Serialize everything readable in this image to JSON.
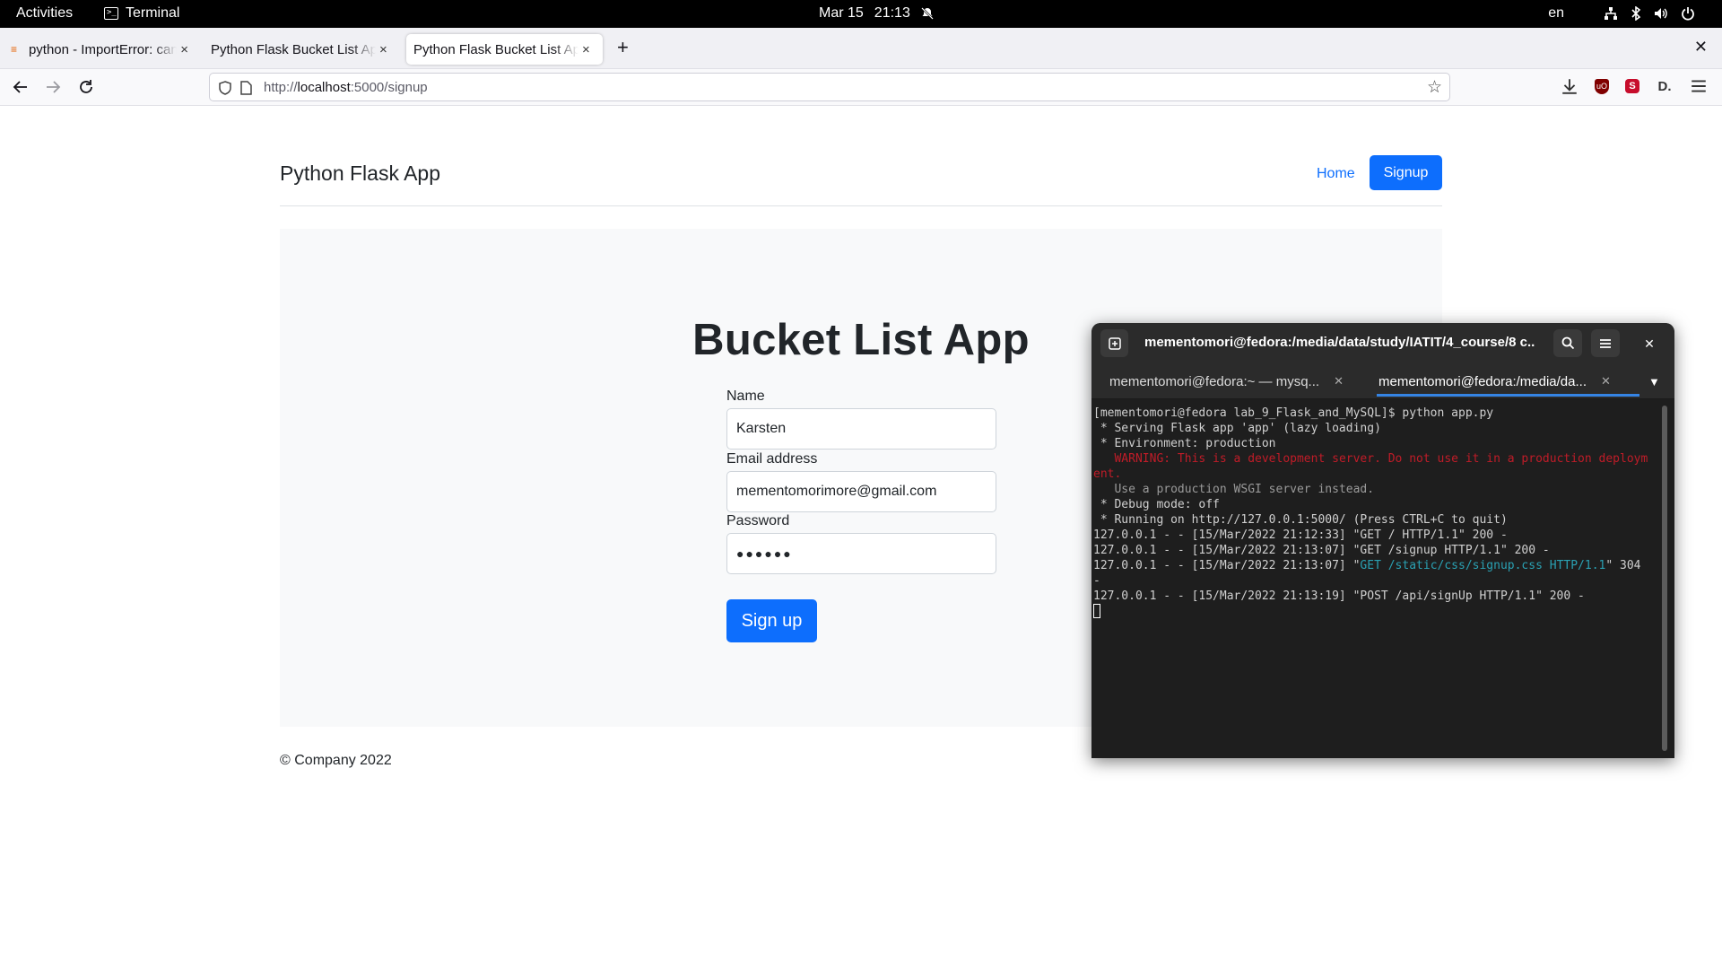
{
  "topbar": {
    "activities": "Activities",
    "app_name": "Terminal",
    "date": "Mar 15",
    "time": "21:13",
    "lang": "en"
  },
  "browser": {
    "tabs": [
      {
        "label": "python - ImportError: cannot import",
        "active": false
      },
      {
        "label": "Python Flask Bucket List App",
        "active": false
      },
      {
        "label": "Python Flask Bucket List App",
        "active": true
      }
    ],
    "url_scheme": "http://",
    "url_host": "localhost",
    "url_path": ":5000/signup"
  },
  "page": {
    "brand": "Python Flask App",
    "nav": {
      "home": "Home",
      "signup": "Signup"
    },
    "heading": "Bucket List App",
    "form": {
      "name_label": "Name",
      "name_value": "Karsten",
      "email_label": "Email address",
      "email_value": "mementomorimore@gmail.com",
      "password_label": "Password",
      "password_value": "●●●●●●",
      "submit_label": "Sign up"
    },
    "footer": "© Company 2022"
  },
  "terminal": {
    "title": "mementomori@fedora:/media/data/study/IATIT/4_course/8 c...",
    "tabs": [
      {
        "label": "mementomori@fedora:~ — mysq...",
        "active": false
      },
      {
        "label": "mementomori@fedora:/media/da...",
        "active": true
      }
    ],
    "lines": {
      "l1": "[mementomori@fedora lab_9_Flask_and_MySQL]$ python app.py",
      "l2": " * Serving Flask app 'app' (lazy loading)",
      "l3": " * Environment: production",
      "l4": "   WARNING: This is a development server. Do not use it in a production deployment.",
      "l5": "   Use a production WSGI server instead.",
      "l6": " * Debug mode: off",
      "l7": " * Running on http://127.0.0.1:5000/ (Press CTRL+C to quit)",
      "l8": "127.0.0.1 - - [15/Mar/2022 21:12:33] \"GET / HTTP/1.1\" 200 -",
      "l9": "127.0.0.1 - - [15/Mar/2022 21:13:07] \"GET /signup HTTP/1.1\" 200 -",
      "l10a": "127.0.0.1 - - [15/Mar/2022 21:13:07] \"",
      "l10b": "GET /static/css/signup.css HTTP/1.1",
      "l10c": "\" 304 -",
      "l11": "127.0.0.1 - - [15/Mar/2022 21:13:19] \"POST /api/signUp HTTP/1.1\" 200 -"
    }
  },
  "colors": {
    "primary": "#0d6efd",
    "jumbotron_bg": "#f8f9fa",
    "terminal_bg": "#1e1e1e",
    "warning": "#c01c28",
    "link_cyan": "#2aa1b3"
  }
}
